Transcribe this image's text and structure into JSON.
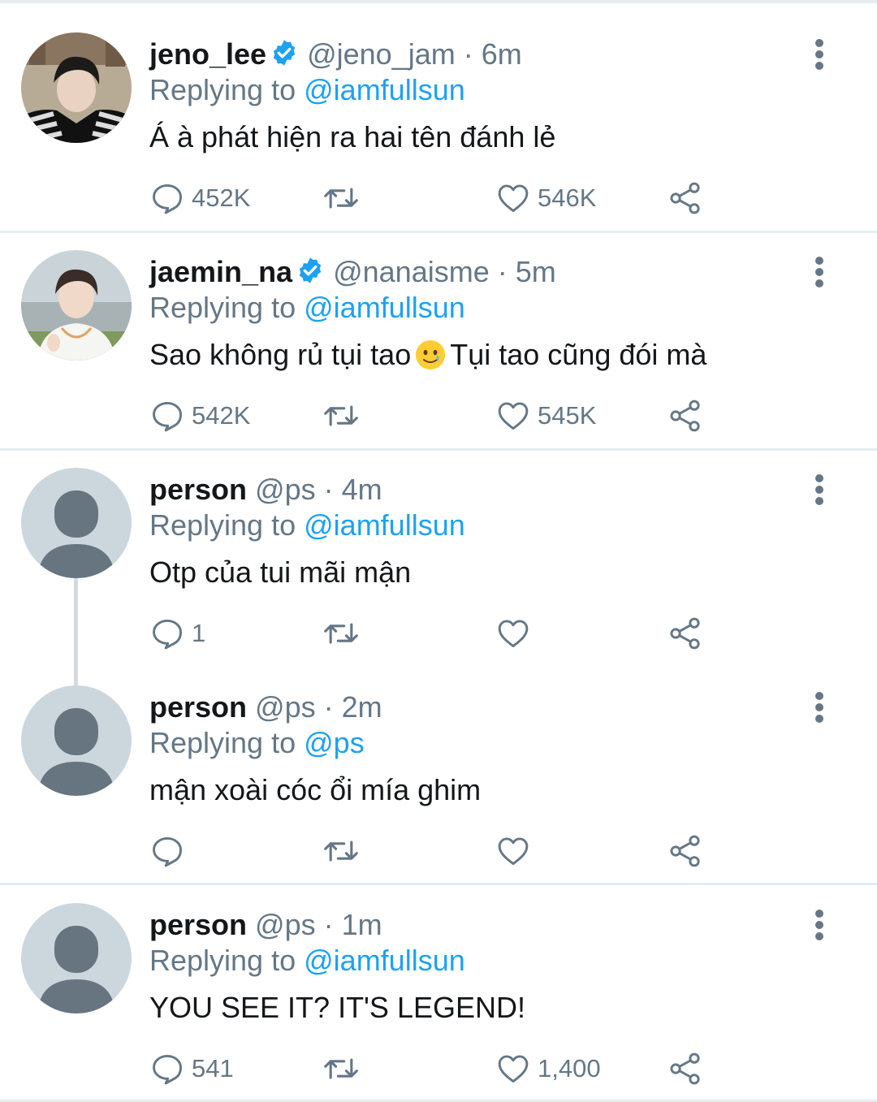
{
  "tweets": [
    {
      "name": "jeno_lee",
      "verified": true,
      "handle": "@jeno_jam",
      "separator": "·",
      "time": "6m",
      "replying_prefix": "Replying to",
      "replying_to": "@iamfullsun",
      "text": "Á à phát hiện ra hai tên đánh lẻ",
      "replies": "452K",
      "retweets": "",
      "likes": "546K",
      "avatar": "photo-avatar"
    },
    {
      "name": "jaemin_na",
      "verified": true,
      "handle": "@nanaisme",
      "separator": "·",
      "time": "5m",
      "replying_prefix": "Replying to",
      "replying_to": "@iamfullsun",
      "text_before": "Sao không rủ tụi tao",
      "emoji": "smiling-face-with-tear",
      "text_after": "Tụi tao cũng đói mà",
      "replies": "542K",
      "retweets": "",
      "likes": "545K",
      "avatar": "photo-avatar"
    },
    {
      "name": "person",
      "verified": false,
      "handle": "@ps",
      "separator": "·",
      "time": "4m",
      "replying_prefix": "Replying to",
      "replying_to": "@iamfullsun",
      "text": "Otp của tui mãi mận",
      "replies": "1",
      "retweets": "",
      "likes": "",
      "avatar": "default-avatar"
    },
    {
      "name": "person",
      "verified": false,
      "handle": "@ps",
      "separator": "·",
      "time": "2m",
      "replying_prefix": "Replying to",
      "replying_to": "@ps",
      "text": "mận xoài cóc ổi mía ghim",
      "replies": "",
      "retweets": "",
      "likes": "",
      "avatar": "default-avatar"
    },
    {
      "name": "person",
      "verified": false,
      "handle": "@ps",
      "separator": "·",
      "time": "1m",
      "replying_prefix": "Replying to",
      "replying_to": "@iamfullsun",
      "text": "YOU SEE IT? IT'S LEGEND!",
      "replies": "541",
      "retweets": "",
      "likes": "1,400",
      "avatar": "default-avatar"
    }
  ],
  "colors": {
    "link": "#1da1f2",
    "secondary_text": "#657786",
    "primary_text": "#14171a",
    "divider": "#e6ecf0",
    "default_avatar_bg": "#ccd6dd",
    "default_avatar_fg": "#66757f"
  },
  "icons": [
    "verified-badge-icon",
    "more-options-icon",
    "reply-icon",
    "retweet-icon",
    "like-icon",
    "share-icon"
  ]
}
